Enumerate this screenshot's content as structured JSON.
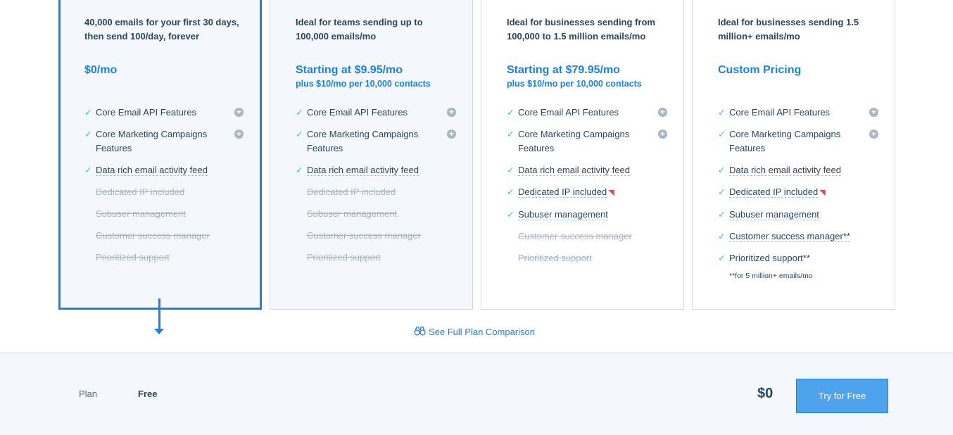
{
  "plans": [
    {
      "description": "40,000 emails for your first 30 days, then send 100/day, forever",
      "price": "$0/mo",
      "price_sub": "",
      "features": [
        {
          "label": "Core Email API Features",
          "enabled": true,
          "expandable": true,
          "dotted": false,
          "icon": ""
        },
        {
          "label": "Core Marketing Campaigns Features",
          "enabled": true,
          "expandable": true,
          "dotted": false,
          "icon": ""
        },
        {
          "label": "Data rich email activity feed",
          "enabled": true,
          "expandable": false,
          "dotted": true,
          "icon": ""
        },
        {
          "label": "Dedicated IP included",
          "enabled": false,
          "expandable": false,
          "dotted": false,
          "icon": ""
        },
        {
          "label": "Subuser management",
          "enabled": false,
          "expandable": false,
          "dotted": false,
          "icon": ""
        },
        {
          "label": "Customer success manager",
          "enabled": false,
          "expandable": false,
          "dotted": false,
          "icon": ""
        },
        {
          "label": "Prioritized support",
          "enabled": false,
          "expandable": false,
          "dotted": false,
          "icon": ""
        }
      ],
      "footnote": ""
    },
    {
      "description": "Ideal for teams sending up to 100,000 emails/mo",
      "price": "Starting at $9.95/mo",
      "price_sub": "plus $10/mo per 10,000 contacts",
      "features": [
        {
          "label": "Core Email API Features",
          "enabled": true,
          "expandable": true,
          "dotted": false,
          "icon": ""
        },
        {
          "label": "Core Marketing Campaigns Features",
          "enabled": true,
          "expandable": true,
          "dotted": false,
          "icon": ""
        },
        {
          "label": "Data rich email activity feed",
          "enabled": true,
          "expandable": false,
          "dotted": true,
          "icon": ""
        },
        {
          "label": "Dedicated IP included",
          "enabled": false,
          "expandable": false,
          "dotted": false,
          "icon": ""
        },
        {
          "label": "Subuser management",
          "enabled": false,
          "expandable": false,
          "dotted": false,
          "icon": ""
        },
        {
          "label": "Customer success manager",
          "enabled": false,
          "expandable": false,
          "dotted": false,
          "icon": ""
        },
        {
          "label": "Prioritized support",
          "enabled": false,
          "expandable": false,
          "dotted": false,
          "icon": ""
        }
      ],
      "footnote": ""
    },
    {
      "description": "Ideal for businesses sending from 100,000 to 1.5 million emails/mo",
      "price": "Starting at $79.95/mo",
      "price_sub": "plus $10/mo per 10,000 contacts",
      "features": [
        {
          "label": "Core Email API Features",
          "enabled": true,
          "expandable": true,
          "dotted": false,
          "icon": ""
        },
        {
          "label": "Core Marketing Campaigns Features",
          "enabled": true,
          "expandable": true,
          "dotted": false,
          "icon": ""
        },
        {
          "label": "Data rich email activity feed",
          "enabled": true,
          "expandable": false,
          "dotted": true,
          "icon": ""
        },
        {
          "label": "Dedicated IP included",
          "enabled": true,
          "expandable": false,
          "dotted": true,
          "icon": "party-popper-icon"
        },
        {
          "label": "Subuser management",
          "enabled": true,
          "expandable": false,
          "dotted": true,
          "icon": ""
        },
        {
          "label": "Customer success manager",
          "enabled": false,
          "expandable": false,
          "dotted": false,
          "icon": ""
        },
        {
          "label": "Prioritized support",
          "enabled": false,
          "expandable": false,
          "dotted": false,
          "icon": ""
        }
      ],
      "footnote": ""
    },
    {
      "description": "Ideal for businesses sending 1.5 million+ emails/mo",
      "price": "Custom Pricing",
      "price_sub": "",
      "features": [
        {
          "label": "Core Email API Features",
          "enabled": true,
          "expandable": true,
          "dotted": false,
          "icon": ""
        },
        {
          "label": "Core Marketing Campaigns Features",
          "enabled": true,
          "expandable": true,
          "dotted": false,
          "icon": ""
        },
        {
          "label": "Data rich email activity feed",
          "enabled": true,
          "expandable": false,
          "dotted": true,
          "icon": ""
        },
        {
          "label": "Dedicated IP included",
          "enabled": true,
          "expandable": false,
          "dotted": true,
          "icon": "party-popper-icon"
        },
        {
          "label": "Subuser management",
          "enabled": true,
          "expandable": false,
          "dotted": true,
          "icon": ""
        },
        {
          "label": "Customer success manager**",
          "enabled": true,
          "expandable": false,
          "dotted": true,
          "icon": ""
        },
        {
          "label": "Prioritized support**",
          "enabled": true,
          "expandable": false,
          "dotted": false,
          "icon": ""
        }
      ],
      "footnote": "**for 5 million+ emails/mo"
    }
  ],
  "compare_link": "See Full Plan Comparison",
  "bottom_bar": {
    "plan_label": "Plan",
    "plan_name": "Free",
    "total": "$0",
    "cta": "Try for Free"
  },
  "colors": {
    "accent": "#1a82e2",
    "check": "#3ed0a0",
    "text": "#294661",
    "disabled": "#a8b6c3"
  }
}
